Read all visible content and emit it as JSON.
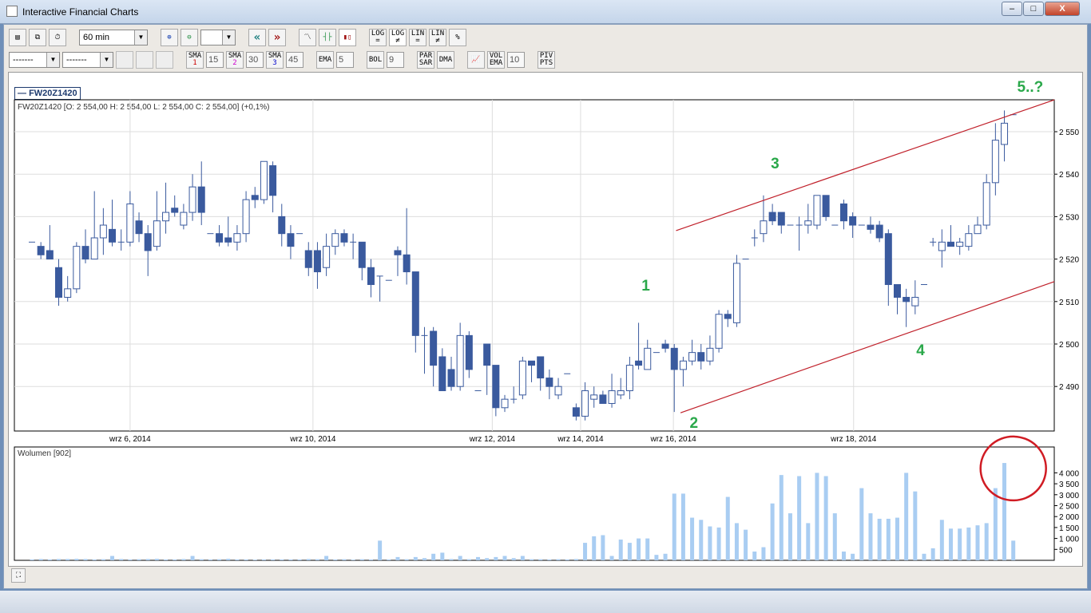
{
  "window": {
    "title": "Interactive Financial Charts",
    "min": "–",
    "max": "□",
    "close": "X"
  },
  "toolbar1": {
    "interval": "60 min",
    "zoom_select": "",
    "log_eq": "LOG =",
    "log_ne": "LOG ≠",
    "lin_eq": "LIN =",
    "lin_ne": "LIN ≠",
    "pct": "%"
  },
  "toolbar2": {
    "line1": "-------",
    "line2": "-------",
    "sma1": {
      "label": "SMA",
      "idx": "1",
      "value": "15"
    },
    "sma2": {
      "label": "SMA",
      "idx": "2",
      "value": "30"
    },
    "sma3": {
      "label": "SMA",
      "idx": "3",
      "value": "45"
    },
    "ema": {
      "label": "EMA",
      "value": "5"
    },
    "bol": {
      "label": "BOL",
      "value": "9"
    },
    "parsar": "PAR SAR",
    "dma": "DMA",
    "volema": {
      "label": "VOL EMA",
      "value": "10"
    },
    "pivpts": "PIV PTS"
  },
  "chart_data": {
    "type": "candlestick",
    "symbol": "FW20Z1420",
    "info": "FW20Z1420 [O: 2 554,00  H: 2 554,00  L: 2 554,00  C: 2 554,00] (+0,1%)",
    "ylim": [
      2480,
      2558
    ],
    "yticks": [
      2490,
      2500,
      2510,
      2520,
      2530,
      2540,
      2550
    ],
    "ytick_labels": [
      "2 490",
      "2 500",
      "2 510",
      "2 520",
      "2 530",
      "2 540",
      "2 550"
    ],
    "xtick_labels": [
      {
        "idx": 11,
        "label": "wrz 6, 2014"
      },
      {
        "idx": 31.5,
        "label": "wrz 10, 2014"
      },
      {
        "idx": 51.6,
        "label": "wrz 12, 2014"
      },
      {
        "idx": 61.5,
        "label": "wrz 14, 2014"
      },
      {
        "idx": 71.9,
        "label": "wrz 16, 2014"
      },
      {
        "idx": 92.1,
        "label": "wrz 18, 2014"
      }
    ],
    "candles": [
      [
        2524,
        2524,
        2524,
        2524
      ],
      [
        2523,
        2524,
        2520,
        2521
      ],
      [
        2522,
        2528,
        2520,
        2520
      ],
      [
        2518,
        2520,
        2509,
        2511
      ],
      [
        2511,
        2516,
        2510,
        2513
      ],
      [
        2513,
        2524,
        2512,
        2523
      ],
      [
        2523,
        2527,
        2519,
        2520
      ],
      [
        2520,
        2536,
        2520,
        2525
      ],
      [
        2525,
        2532,
        2521,
        2528
      ],
      [
        2527,
        2534,
        2523,
        2524
      ],
      [
        2524,
        2527,
        2522,
        2524
      ],
      [
        2524,
        2536,
        2523,
        2533
      ],
      [
        2529,
        2531,
        2524,
        2526
      ],
      [
        2526,
        2528,
        2516,
        2522
      ],
      [
        2523,
        2536,
        2522,
        2529
      ],
      [
        2529,
        2538,
        2526,
        2531
      ],
      [
        2532,
        2535,
        2530,
        2531
      ],
      [
        2528,
        2533,
        2527,
        2531
      ],
      [
        2531,
        2540,
        2529,
        2537
      ],
      [
        2537,
        2543,
        2528,
        2531
      ],
      [
        2526,
        2526,
        2526,
        2526
      ],
      [
        2526,
        2528,
        2523,
        2524
      ],
      [
        2525,
        2530,
        2523,
        2524
      ],
      [
        2524,
        2528,
        2522,
        2526
      ],
      [
        2526,
        2536,
        2524,
        2534
      ],
      [
        2535,
        2537,
        2532,
        2534
      ],
      [
        2534,
        2543,
        2533,
        2543
      ],
      [
        2542,
        2543,
        2531,
        2535
      ],
      [
        2530,
        2533,
        2523,
        2526
      ],
      [
        2526,
        2528,
        2520,
        2523
      ],
      [
        2526,
        2526,
        2526,
        2526
      ],
      [
        2522,
        2524,
        2516,
        2518
      ],
      [
        2522,
        2524,
        2513,
        2517
      ],
      [
        2518,
        2526,
        2516,
        2523
      ],
      [
        2523,
        2527,
        2521,
        2526
      ],
      [
        2526,
        2527,
        2523,
        2524
      ],
      [
        2524,
        2526,
        2520,
        2524
      ],
      [
        2524,
        2524,
        2515,
        2518
      ],
      [
        2518,
        2520,
        2511,
        2514
      ],
      [
        2516,
        2516,
        2510,
        2516
      ],
      [
        2515,
        2515,
        2515,
        2515
      ],
      [
        2522,
        2523,
        2516,
        2521
      ],
      [
        2521,
        2532,
        2514,
        2517
      ],
      [
        2517,
        2517,
        2498,
        2502
      ],
      [
        2502,
        2504,
        2493,
        2502
      ],
      [
        2503,
        2504,
        2490,
        2495
      ],
      [
        2497,
        2499,
        2489,
        2489
      ],
      [
        2494,
        2497,
        2489,
        2490
      ],
      [
        2490,
        2505,
        2489,
        2502
      ],
      [
        2502,
        2503,
        2492,
        2494
      ],
      [
        2489,
        2489,
        2489,
        2489
      ],
      [
        2500,
        2500,
        2488,
        2495
      ],
      [
        2495,
        2495,
        2483,
        2485
      ],
      [
        2485,
        2488,
        2484,
        2487
      ],
      [
        2487,
        2490,
        2486,
        2487
      ],
      [
        2488,
        2497,
        2487,
        2496
      ],
      [
        2496,
        2496,
        2491,
        2495
      ],
      [
        2497,
        2497,
        2489,
        2492
      ],
      [
        2492,
        2494,
        2487,
        2490
      ],
      [
        2488,
        2492,
        2487,
        2490
      ],
      [
        2493,
        2493,
        2493,
        2493
      ],
      [
        2485,
        2486,
        2482,
        2483
      ],
      [
        2483,
        2491,
        2482,
        2489
      ],
      [
        2487,
        2490,
        2485,
        2488
      ],
      [
        2488,
        2489,
        2486,
        2486
      ],
      [
        2486,
        2493,
        2485,
        2489
      ],
      [
        2488,
        2492,
        2487,
        2489
      ],
      [
        2489,
        2497,
        2487,
        2495
      ],
      [
        2496,
        2505,
        2494,
        2495
      ],
      [
        2494,
        2501,
        2494,
        2499
      ],
      [
        2498,
        2498,
        2498,
        2498
      ],
      [
        2500,
        2501,
        2498,
        2499
      ],
      [
        2499,
        2500,
        2484,
        2494
      ],
      [
        2494,
        2497,
        2490,
        2496
      ],
      [
        2496,
        2501,
        2495,
        2498
      ],
      [
        2498,
        2500,
        2494,
        2496
      ],
      [
        2496,
        2502,
        2495,
        2499
      ],
      [
        2499,
        2508,
        2498,
        2507
      ],
      [
        2507,
        2508,
        2504,
        2506
      ],
      [
        2505,
        2521,
        2504,
        2519
      ],
      [
        2520,
        2520,
        2520,
        2520
      ],
      [
        2525,
        2527,
        2523,
        2525
      ],
      [
        2526,
        2535,
        2524,
        2529
      ],
      [
        2531,
        2533,
        2528,
        2529
      ],
      [
        2531,
        2531,
        2526,
        2528
      ],
      [
        2528,
        2528,
        2528,
        2528
      ],
      [
        2528,
        2530,
        2522,
        2528
      ],
      [
        2528,
        2533,
        2526,
        2529
      ],
      [
        2528,
        2535,
        2527,
        2535
      ],
      [
        2535,
        2535,
        2529,
        2530
      ],
      [
        2528,
        2528,
        2528,
        2528
      ],
      [
        2533,
        2534,
        2527,
        2529
      ],
      [
        2530,
        2531,
        2525,
        2528
      ],
      [
        2528,
        2528,
        2528,
        2528
      ],
      [
        2528,
        2530,
        2526,
        2527
      ],
      [
        2528,
        2529,
        2524,
        2525
      ],
      [
        2526,
        2527,
        2509,
        2514
      ],
      [
        2514,
        2514,
        2507,
        2511
      ],
      [
        2511,
        2513,
        2504,
        2510
      ],
      [
        2509,
        2515,
        2507,
        2511
      ],
      [
        2514,
        2514,
        2514,
        2514
      ],
      [
        2524,
        2525,
        2523,
        2524
      ],
      [
        2522,
        2527,
        2518,
        2524
      ],
      [
        2524,
        2528,
        2523,
        2523
      ],
      [
        2523,
        2525,
        2521,
        2524
      ],
      [
        2523,
        2528,
        2522,
        2526
      ],
      [
        2526,
        2530,
        2526,
        2528
      ],
      [
        2528,
        2540,
        2527,
        2538
      ],
      [
        2538,
        2552,
        2535,
        2548
      ],
      [
        2547,
        2555,
        2543,
        2552
      ],
      [
        2554,
        2554,
        2554,
        2554
      ]
    ],
    "volume_title": "Wolumen [902]",
    "volume_ylim": [
      0,
      4700
    ],
    "volume_ticks": [
      500,
      1000,
      1500,
      2000,
      2500,
      3000,
      3500,
      4000
    ],
    "volume_tick_labels": [
      "500",
      "1 000",
      "1 500",
      "2 000",
      "2 500",
      "3 000",
      "3 500",
      "4 000"
    ],
    "volumes": [
      40,
      60,
      40,
      60,
      60,
      70,
      60,
      40,
      50,
      200,
      60,
      40,
      50,
      60,
      70,
      40,
      40,
      60,
      200,
      50,
      40,
      50,
      70,
      40,
      40,
      30,
      40,
      40,
      40,
      40,
      40,
      60,
      50,
      200,
      40,
      50,
      30,
      50,
      40,
      900,
      40,
      150,
      50,
      150,
      100,
      300,
      350,
      60,
      200,
      50,
      150,
      100,
      150,
      200,
      100,
      200,
      50,
      50,
      40,
      50,
      40,
      60,
      800,
      1100,
      1150,
      200,
      950,
      800,
      1000,
      1000,
      250,
      300,
      3050,
      3050,
      1950,
      1850,
      1550,
      1500,
      2900,
      1700,
      1400,
      400,
      600,
      2600,
      3900,
      2150,
      3850,
      1700,
      4000,
      3850,
      2150,
      400,
      300,
      3300,
      2150,
      1900,
      1900,
      1950,
      4000,
      3150,
      300,
      550,
      1850,
      1450,
      1450,
      1500,
      1600,
      1700,
      3300,
      4450,
      900
    ],
    "upper_channel": [
      [
        72.2,
        2526.7
      ],
      [
        114.6,
        2557.5
      ]
    ],
    "lower_channel": [
      [
        72.7,
        2483.8
      ],
      [
        114.6,
        2514.7
      ]
    ],
    "wave_labels": [
      {
        "text": "1",
        "idx": 68.8,
        "price": 2513.9
      },
      {
        "text": "2",
        "idx": 74.2,
        "price": 2481.6
      },
      {
        "text": "3",
        "idx": 83.3,
        "price": 2542.7
      },
      {
        "text": "4",
        "idx": 99.6,
        "price": 2498.7
      },
      {
        "text": "5..?",
        "idx": 111.9,
        "price": 2560.7
      }
    ],
    "volume_highlight": {
      "idx": 110,
      "volume": 4200
    },
    "colors": {
      "down": "#3a5a9e",
      "up": "#ffffff",
      "outline": "#3a5a9e",
      "volume": "#a9cdf2",
      "channel": "#c0202a",
      "wave": "#2aa84a",
      "circle": "#d01c24"
    }
  }
}
